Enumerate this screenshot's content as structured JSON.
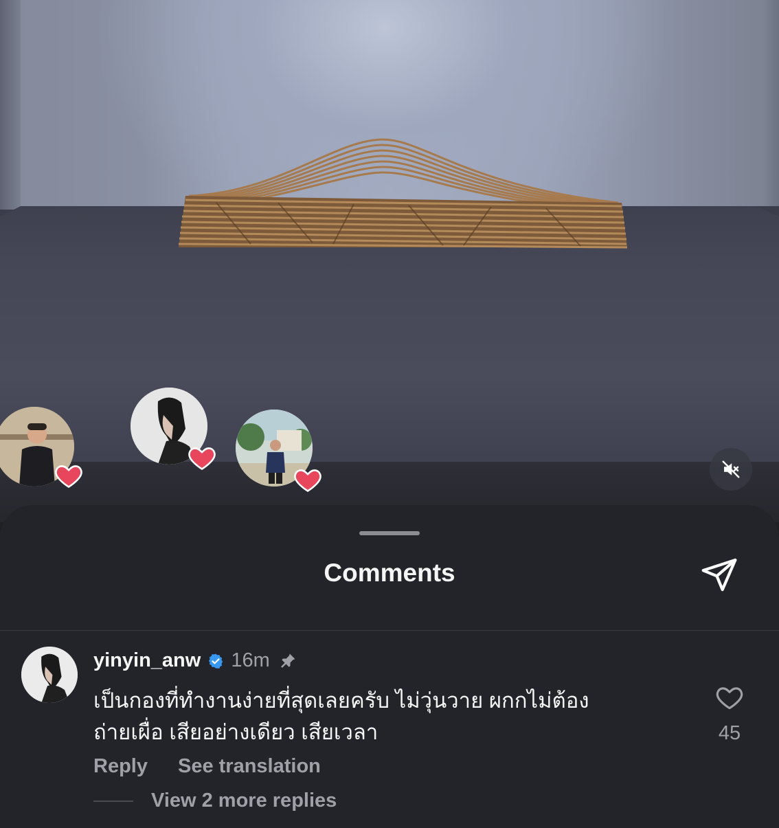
{
  "post": {
    "mute_icon": "speaker-muted-icon",
    "reaction_avatars": [
      {
        "name": "reactor-avatar-1",
        "heart_color": "#e8465c"
      },
      {
        "name": "reactor-avatar-2",
        "heart_color": "#e8465c"
      },
      {
        "name": "reactor-avatar-3",
        "heart_color": "#e8465c"
      }
    ]
  },
  "comments_sheet": {
    "title": "Comments",
    "share_icon": "send-icon"
  },
  "comment": {
    "username": "yinyin_anw",
    "verified": true,
    "time": "16m",
    "pinned": true,
    "text_line1": "เป็นกองที่ทำงานง่ายที่สุดเลยครับ ไม่วุ่นวาย ผกกไม่ต้อง",
    "text_line2": "ถ่ายเผื่อ เสียอย่างเดียว เสียเวลา",
    "reply_label": "Reply",
    "translate_label": "See translation",
    "view_replies_label": "View 2 more replies",
    "like_count": "45"
  },
  "colors": {
    "sheet_background": "#232429",
    "secondary_text": "#a0a1a8",
    "verified_blue": "#3897f0",
    "heart_red": "#e8465c"
  }
}
